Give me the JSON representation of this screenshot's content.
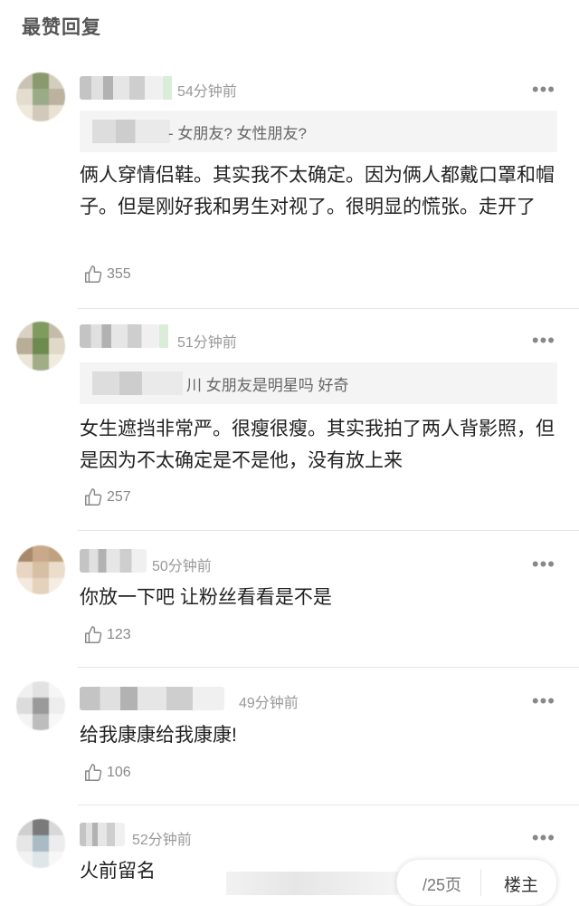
{
  "section_title": "最赞回复",
  "comments": [
    {
      "time": "54分钟前",
      "quote": "- 女朋友? 女性朋友?",
      "text": "俩人穿情侣鞋。其实我不太确定。因为俩人都戴口罩和帽子。但是刚好我和男生对视了。很明显的慌张。走开了",
      "likes": "355"
    },
    {
      "time": "51分钟前",
      "quote": "川 女朋友是明星吗 好奇",
      "text": "女生遮挡非常严。很瘦很瘦。其实我拍了两人背影照，但是因为不太确定是不是他，没有放上来",
      "likes": "257"
    },
    {
      "time": "50分钟前",
      "text": "你放一下吧 让粉丝看看是不是",
      "likes": "123"
    },
    {
      "time": "49分钟前",
      "text": "给我康康给我康康!",
      "likes": "106"
    },
    {
      "time": "52分钟前",
      "text": "火前留名"
    }
  ],
  "more_icon": "•••",
  "bottom_bar": {
    "page_info": "/25页",
    "floor_label": "楼主"
  },
  "colors": {
    "text": "#222222",
    "muted": "#999999",
    "quote_bg": "#f4f4f4",
    "divider": "#e6e6e6"
  }
}
